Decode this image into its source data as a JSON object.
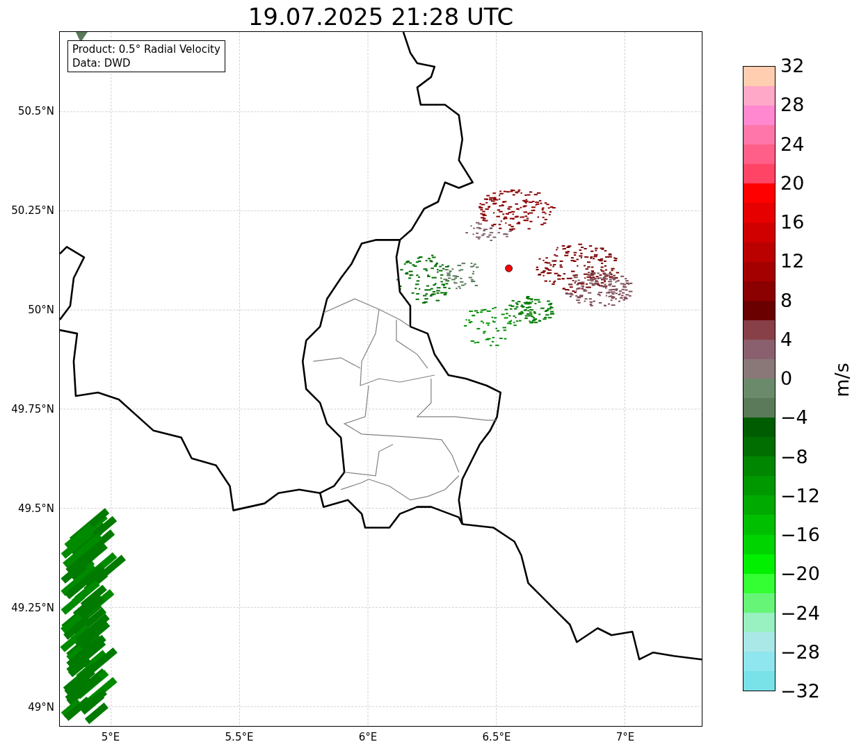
{
  "title": "19.07.2025 21:28 UTC",
  "info_box": [
    "Product: 0.5° Radial Velocity",
    "Data: DWD"
  ],
  "map": {
    "x_ticks": [
      "5°E",
      "5.5°E",
      "6°E",
      "6.5°E",
      "7°E"
    ],
    "y_ticks": [
      "50.5°N",
      "50.25°N",
      "50°N",
      "49.75°N",
      "49.5°N",
      "49.25°N",
      "49°N"
    ],
    "radar_site": {
      "color": "#ff0000"
    }
  },
  "colorbar": {
    "label": "m/s",
    "ticks": [
      "32",
      "28",
      "24",
      "20",
      "16",
      "12",
      "8",
      "4",
      "0",
      "−4",
      "−8",
      "−12",
      "−16",
      "−20",
      "−24",
      "−28",
      "−32"
    ],
    "bands": [
      {
        "color": "#ffcdaf"
      },
      {
        "color": "#ffa8c8"
      },
      {
        "color": "#ff88d0"
      },
      {
        "color": "#ff77aa"
      },
      {
        "color": "#ff5f88"
      },
      {
        "color": "#ff4466"
      },
      {
        "color": "#ff0000"
      },
      {
        "color": "#e60000"
      },
      {
        "color": "#d00000"
      },
      {
        "color": "#bb0000"
      },
      {
        "color": "#a50000"
      },
      {
        "color": "#8b0000"
      },
      {
        "color": "#6b0000"
      },
      {
        "color": "#884048"
      },
      {
        "color": "#8a606e"
      },
      {
        "color": "#8a7878"
      },
      {
        "color": "#6b8a6b"
      },
      {
        "color": "#5a7a5a"
      },
      {
        "color": "#005c00"
      },
      {
        "color": "#006e00"
      },
      {
        "color": "#008600"
      },
      {
        "color": "#009800"
      },
      {
        "color": "#00aa00"
      },
      {
        "color": "#00bf00"
      },
      {
        "color": "#00d400"
      },
      {
        "color": "#00f000"
      },
      {
        "color": "#33ff33"
      },
      {
        "color": "#66f577"
      },
      {
        "color": "#99f0c0"
      },
      {
        "color": "#aae8e8"
      },
      {
        "color": "#90e6ee"
      },
      {
        "color": "#78e2e8"
      }
    ]
  }
}
